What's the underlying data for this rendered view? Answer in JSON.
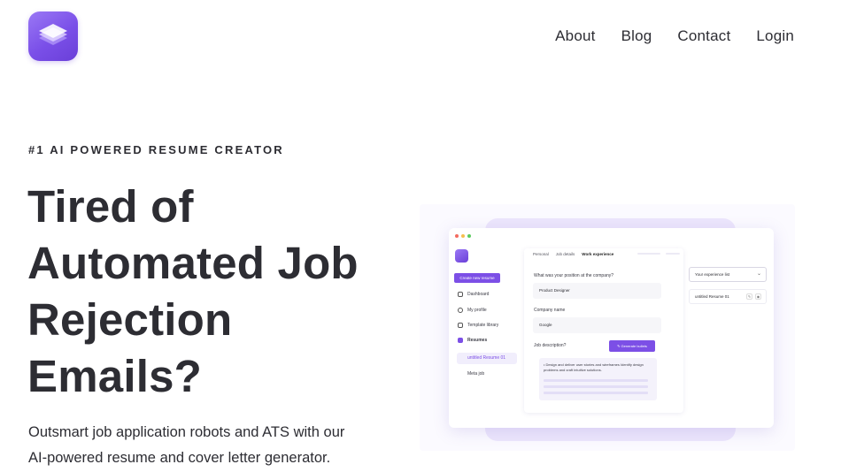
{
  "brand": {
    "accent": "#7c4fe6",
    "text": "#2d2d33"
  },
  "nav": {
    "items": [
      "About",
      "Blog",
      "Contact",
      "Login"
    ]
  },
  "hero": {
    "eyebrow": "#1 AI POWERED RESUME CREATOR",
    "headline": [
      "Tired of",
      "Automated Job",
      "Rejection",
      "Emails?"
    ],
    "subtext": [
      "Outsmart job application robots and ATS with our",
      "AI-powered resume and cover letter generator."
    ]
  },
  "mockup": {
    "create_button": "Create new resume",
    "sidebar": [
      "Dashboard",
      "My profile",
      "Template library",
      "Resumes"
    ],
    "sidebar_sub": [
      "untitled Resume 01",
      "Meta job"
    ],
    "tabs": [
      "Personal",
      "Job details",
      "Work experience"
    ],
    "fields": {
      "position_label": "What was your position at the company?",
      "position_value": "Product Designer",
      "company_label": "Company name",
      "company_value": "Google",
      "description_label": "Job description?",
      "generate_button": "Generate bullets",
      "description_text": "•  Design and deliver user stories and wireframes Identify design problems and craft intuitive solutions."
    },
    "experience_select": "Your experience list",
    "experience_item": "untitled Resume 01"
  },
  "icons": [
    "logo-icon",
    "home-icon",
    "user-icon",
    "file-icon",
    "resume-icon",
    "wand-icon",
    "chevron-down-icon",
    "edit-icon",
    "eye-icon"
  ]
}
